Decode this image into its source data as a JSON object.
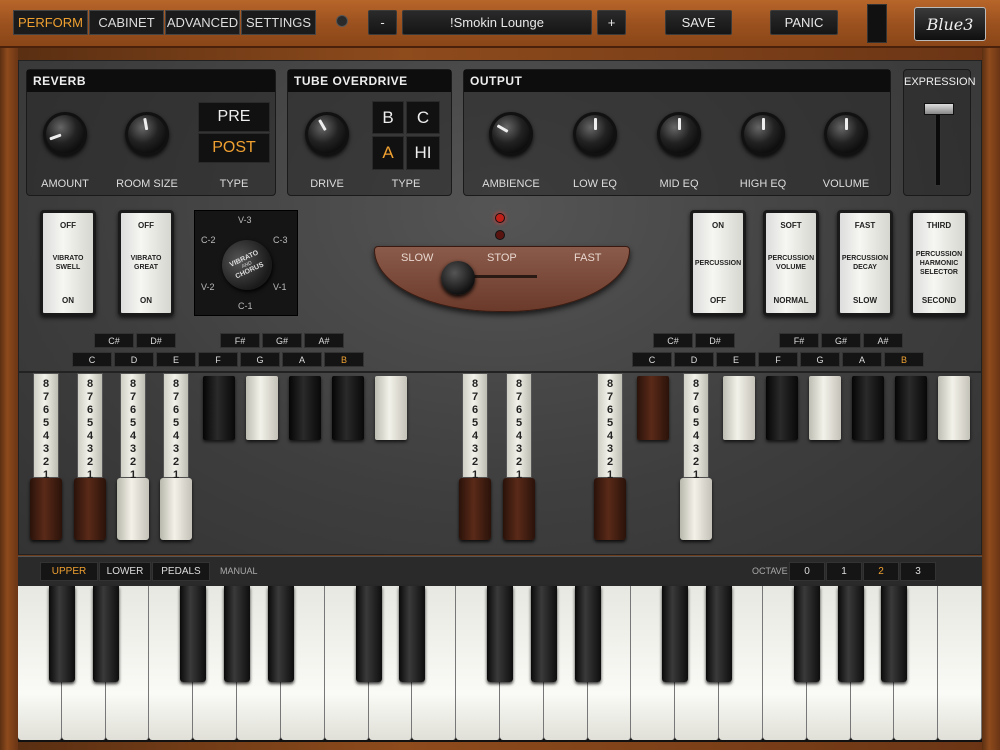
{
  "nav": {
    "tabs": [
      "PERFORM",
      "CABINET",
      "ADVANCED",
      "SETTINGS"
    ],
    "active_tab": "PERFORM",
    "preset_minus": "-",
    "preset_name": "!Smokin Lounge",
    "preset_plus": "+",
    "save": "SAVE",
    "panic": "PANIC",
    "logo": "Blue3"
  },
  "reverb": {
    "title": "REVERB",
    "amount_label": "AMOUNT",
    "room_size_label": "ROOM SIZE",
    "type_label": "TYPE",
    "type_options": [
      "PRE",
      "POST"
    ],
    "type_selected": "POST"
  },
  "overdrive": {
    "title": "TUBE OVERDRIVE",
    "drive_label": "DRIVE",
    "type_label": "TYPE",
    "type_options": [
      "B",
      "C",
      "A",
      "HI"
    ],
    "type_selected": "A"
  },
  "output": {
    "title": "OUTPUT",
    "knobs": [
      "AMBIENCE",
      "LOW EQ",
      "MID EQ",
      "HIGH EQ",
      "VOLUME"
    ]
  },
  "expression": {
    "title": "EXPRESSION"
  },
  "switches": {
    "vibrato_swell": {
      "top": "OFF",
      "mid": "VIBRATO SWELL",
      "bottom": "ON"
    },
    "vibrato_great": {
      "top": "OFF",
      "mid": "VIBRATO GREAT",
      "bottom": "ON"
    },
    "percussion": {
      "top": "ON",
      "mid": "PERCUSSION",
      "bottom": "OFF"
    },
    "percussion_volume": {
      "top": "SOFT",
      "mid": "PERCUSSION VOLUME",
      "bottom": "NORMAL"
    },
    "percussion_decay": {
      "top": "FAST",
      "mid": "PERCUSSION DECAY",
      "bottom": "SLOW"
    },
    "harmonic_selector": {
      "top": "THIRD",
      "mid": "PERCUSSION HARMONIC SELECTOR",
      "bottom": "SECOND"
    }
  },
  "vibrato_chorus": {
    "positions": [
      "V-3",
      "C-2",
      "C-3",
      "V-2",
      "V-1",
      "C-1"
    ],
    "center_text_1": "VIBRATO",
    "center_text_2": "AND",
    "center_text_3": "CHORUS"
  },
  "leslie": {
    "slow": "SLOW",
    "stop": "STOP",
    "fast": "FAST"
  },
  "upper_keys": {
    "sharps": [
      "C#",
      "D#",
      "F#",
      "G#",
      "A#"
    ],
    "naturals": [
      "C",
      "D",
      "E",
      "F",
      "G",
      "A",
      "B"
    ],
    "selected": "B"
  },
  "lower_keys": {
    "sharps": [
      "C#",
      "D#",
      "F#",
      "G#",
      "A#"
    ],
    "naturals": [
      "C",
      "D",
      "E",
      "F",
      "G",
      "A",
      "B"
    ],
    "selected": "B"
  },
  "drawbar_numbers": [
    "8",
    "7",
    "6",
    "5",
    "4",
    "3",
    "2",
    "1"
  ],
  "manual": {
    "tabs": [
      "UPPER",
      "LOWER",
      "PEDALS"
    ],
    "selected": "UPPER",
    "label": "MANUAL",
    "octave_label": "OCTAVE",
    "octaves": [
      "0",
      "1",
      "2",
      "3"
    ],
    "octave_selected": "2"
  }
}
